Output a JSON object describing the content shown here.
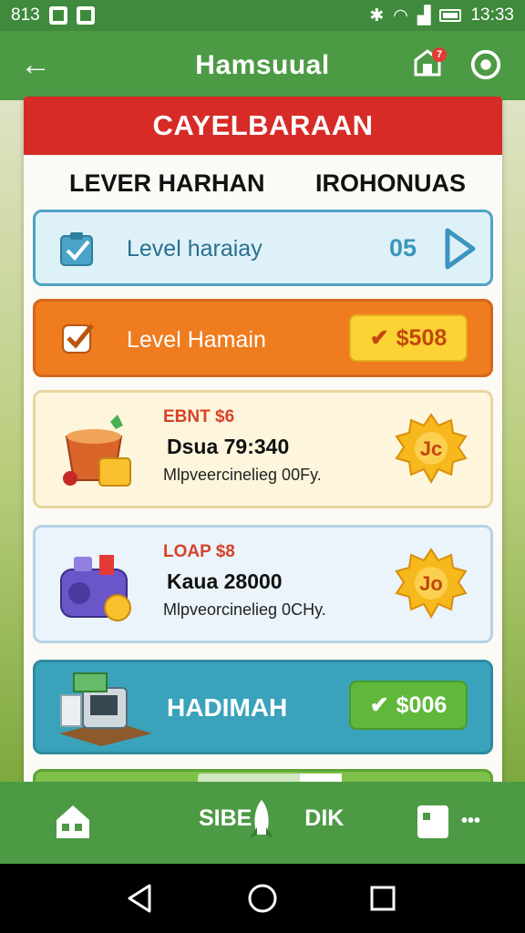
{
  "status_bar": {
    "left_text": "813",
    "time": "13:33"
  },
  "app_bar": {
    "title": "Hamsuual",
    "notification_count": "7"
  },
  "panel": {
    "header": "CAYELBARAAN",
    "column_left": "LEVER HARHAN",
    "column_right": "IROHONUAS"
  },
  "cards": {
    "level_blue": {
      "label": "Level haraiay",
      "count": "05"
    },
    "level_orange": {
      "label": "Level Hamain",
      "price": "$508"
    },
    "offer_1": {
      "tag": "EBNT $6",
      "name": "Dsua 79:340",
      "desc": "Mlpveercinelieg 00Fy.",
      "badge": "Jc"
    },
    "offer_2": {
      "tag": "LOAP $8",
      "name": "Kaua 28000",
      "desc": "Mlpveorcinelieg 0CHy.",
      "badge": "Jo"
    },
    "hadiah": {
      "label": "HADIMAH",
      "price": "$006"
    }
  },
  "bottom_nav": {
    "center_label_left": "SIBE",
    "center_label_right": "DIK",
    "dots": "•••"
  },
  "colors": {
    "green_bar": "#4d9a45",
    "red_header": "#d62b26",
    "orange": "#ef7c1f",
    "teal": "#3aa3bb"
  }
}
